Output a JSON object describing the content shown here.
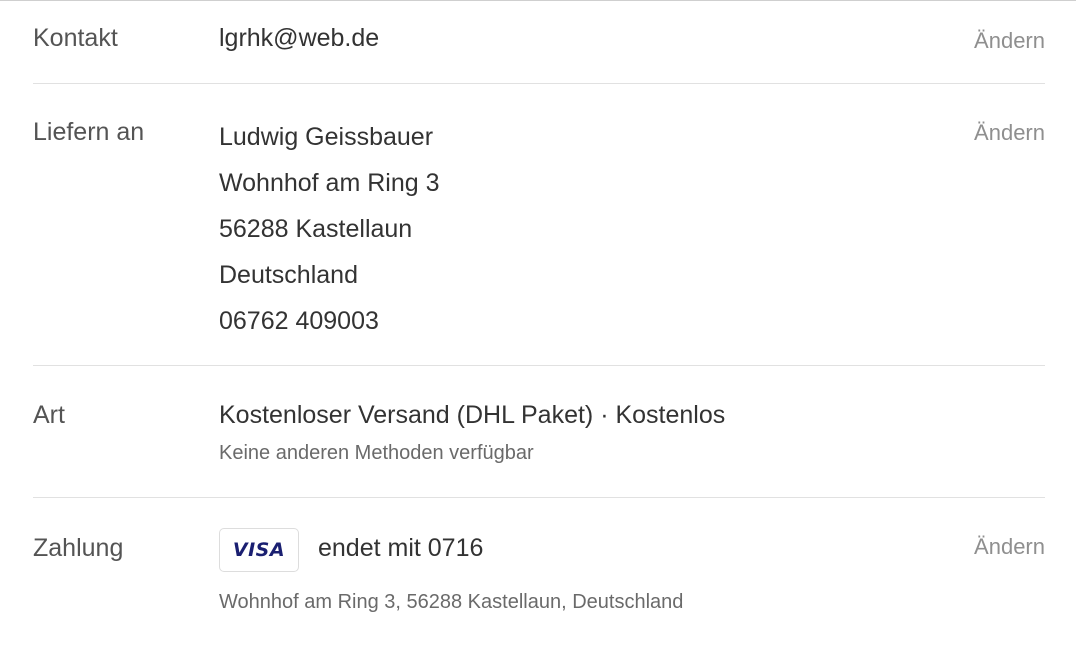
{
  "contact": {
    "label": "Kontakt",
    "email": "lgrhk@web.de",
    "change_label": "Ändern"
  },
  "ship_to": {
    "label": "Liefern an",
    "lines": [
      "Ludwig Geissbauer",
      "Wohnhof am Ring 3",
      "56288 Kastellaun",
      "Deutschland",
      "06762 409003"
    ],
    "change_label": "Ändern"
  },
  "method": {
    "label": "Art",
    "value": "Kostenloser Versand (DHL Paket) · Kostenlos",
    "note": "Keine anderen Methoden verfügbar"
  },
  "payment": {
    "label": "Zahlung",
    "card_brand": "VISA",
    "card_text": "endet mit 0716",
    "billing_address": "Wohnhof am Ring 3, 56288 Kastellaun, Deutschland",
    "change_label": "Ändern",
    "brand_color": "#1a1f71"
  },
  "icons": {
    "card_brand_icon": "visa-logo-icon"
  }
}
